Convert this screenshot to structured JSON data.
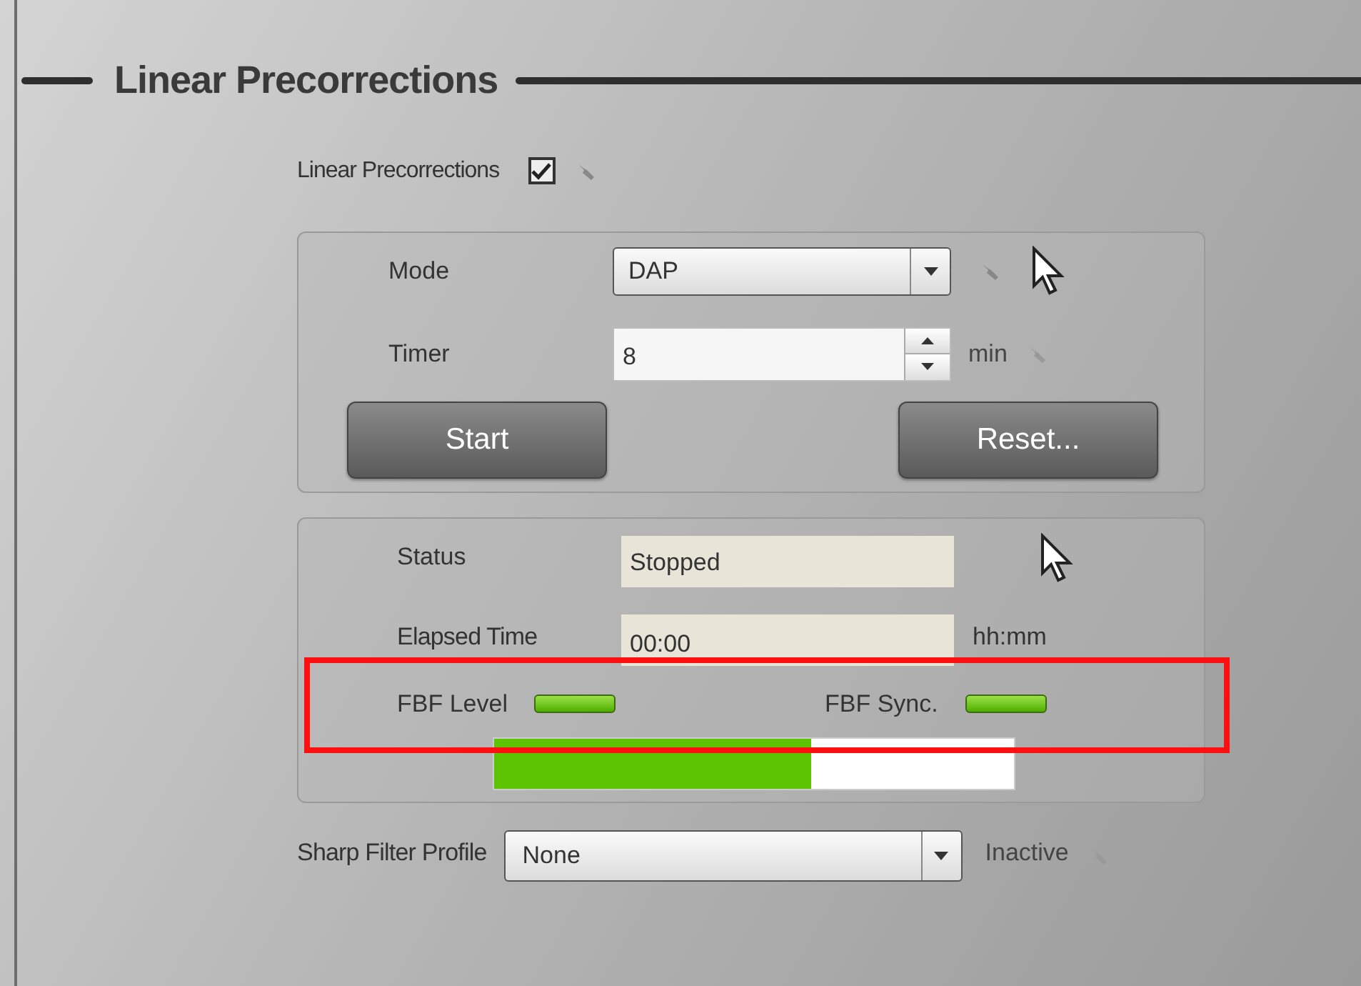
{
  "section": {
    "title": "Linear Precorrections"
  },
  "enable": {
    "label": "Linear Precorrections",
    "checked": true
  },
  "mode": {
    "label": "Mode",
    "value": "DAP"
  },
  "timer": {
    "label": "Timer",
    "value": "8",
    "unit": "min"
  },
  "buttons": [
    {
      "label": "Start"
    },
    {
      "label": "Reset..."
    }
  ],
  "status": {
    "label": "Status",
    "value": "Stopped"
  },
  "elapsed": {
    "label": "Elapsed Time",
    "value": "00:00",
    "unit": "hh:mm"
  },
  "indicators": [
    {
      "label": "FBF Level",
      "on": true
    },
    {
      "label": "FBF Sync.",
      "on": true
    }
  ],
  "progress": {
    "level": 0.61
  },
  "sharp_filter": {
    "label": "Sharp Filter Profile",
    "value": "None",
    "state": "Inactive"
  }
}
